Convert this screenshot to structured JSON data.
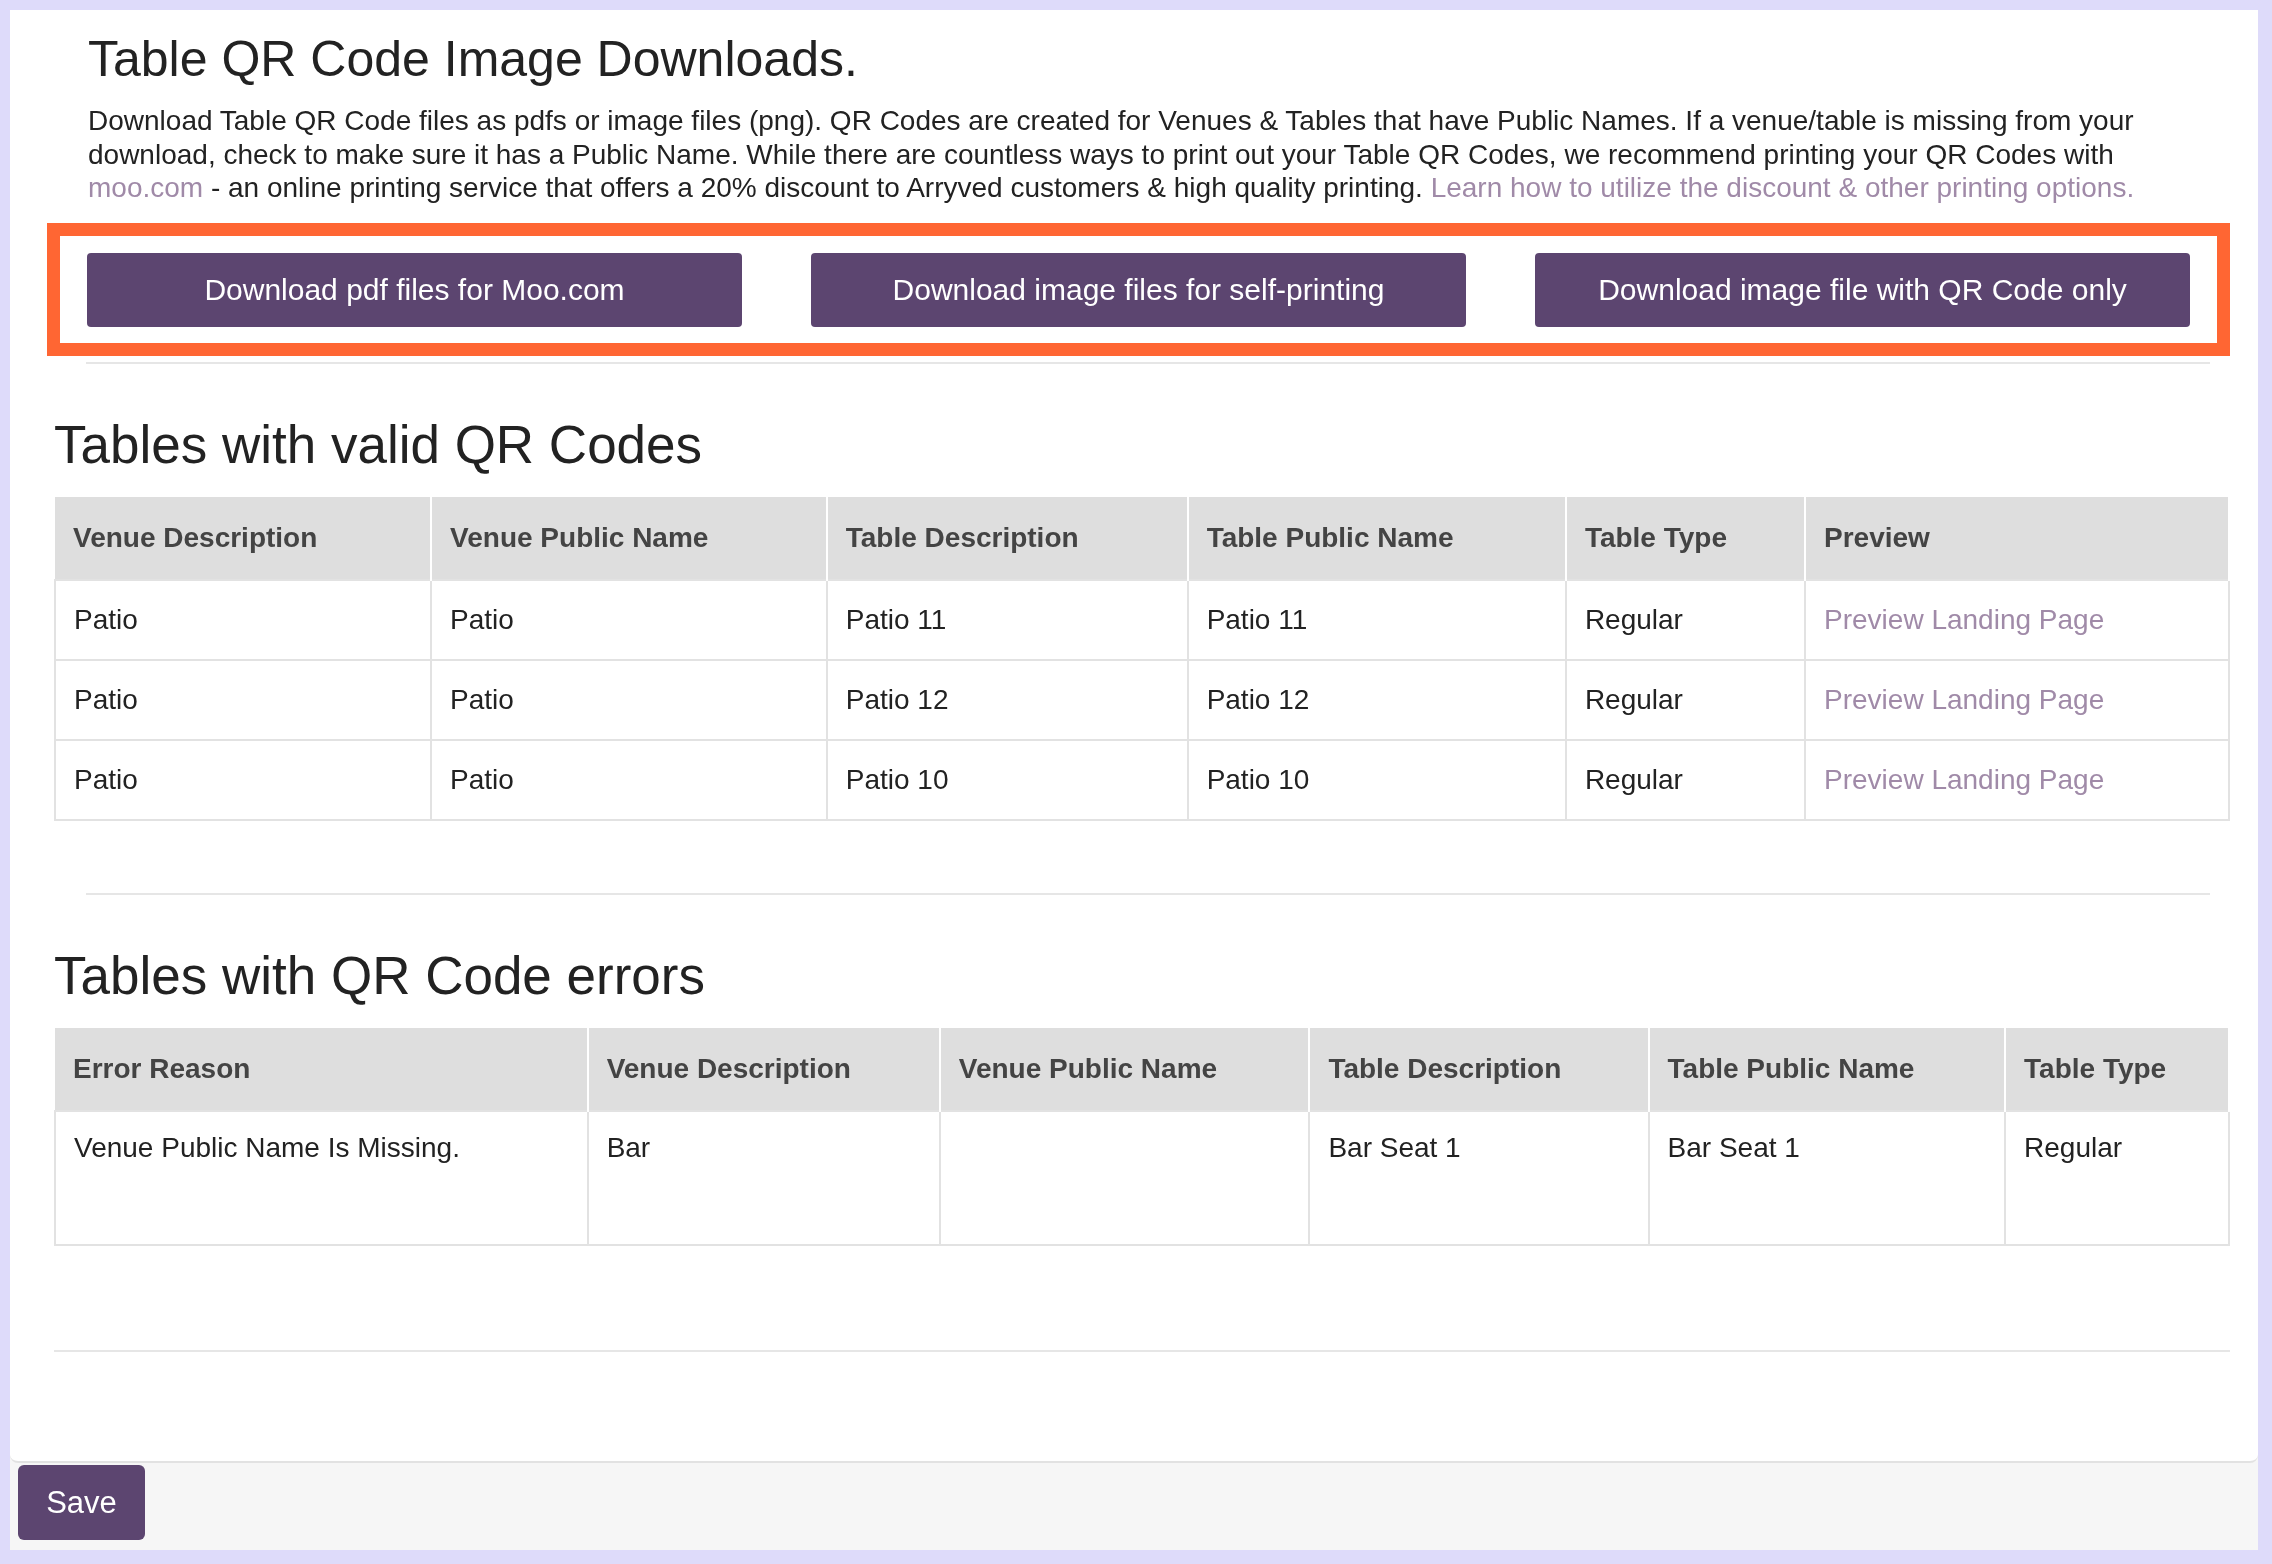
{
  "title": "Table QR Code Image Downloads.",
  "intro": [
    {
      "kind": "text",
      "text": "Download Table QR Code files as pdfs or image files (png). QR Codes are created for Venues & Tables that have Public Names. If a venue/table is missing from your download, check to make sure it has a Public Name. While there are countless ways to print out your Table QR Codes, we recommend printing your QR Codes with "
    },
    {
      "kind": "link",
      "text": "moo.com"
    },
    {
      "kind": "text",
      "text": " - an online printing service that offers a 20% discount to Arryved customers & high quality printing. "
    },
    {
      "kind": "link",
      "text": "Learn how to utilize the discount & other printing options."
    }
  ],
  "download_buttons": [
    "Download pdf files for Moo.com",
    "Download image files for self-printing",
    "Download image file with QR Code only"
  ],
  "tables": [
    {
      "heading": "Tables with valid QR Codes",
      "columns": [
        {
          "label": "Venue Description",
          "kind": "text"
        },
        {
          "label": "Venue Public Name",
          "kind": "text"
        },
        {
          "label": "Table Description",
          "kind": "text"
        },
        {
          "label": "Table Public Name",
          "kind": "text"
        },
        {
          "label": "Table Type",
          "kind": "text"
        },
        {
          "label": "Preview",
          "kind": "link"
        }
      ],
      "rows": [
        [
          "Patio",
          "Patio",
          "Patio 11",
          "Patio 11",
          "Regular",
          "Preview Landing Page"
        ],
        [
          "Patio",
          "Patio",
          "Patio 12",
          "Patio 12",
          "Regular",
          "Preview Landing Page"
        ],
        [
          "Patio",
          "Patio",
          "Patio 10",
          "Patio 10",
          "Regular",
          "Preview Landing Page"
        ]
      ]
    },
    {
      "heading": "Tables with QR Code errors",
      "columns": [
        {
          "label": "Error Reason"
        },
        {
          "label": "Venue Description"
        },
        {
          "label": "Venue Public Name"
        },
        {
          "label": "Table Description"
        },
        {
          "label": "Table Public Name"
        },
        {
          "label": "Table Type"
        }
      ],
      "rows": [
        [
          "Venue Public Name Is Missing.",
          "Bar",
          null,
          "Bar Seat 1",
          "Bar Seat 1",
          "Regular"
        ]
      ]
    }
  ],
  "footer": {
    "save_button": "Save"
  }
}
